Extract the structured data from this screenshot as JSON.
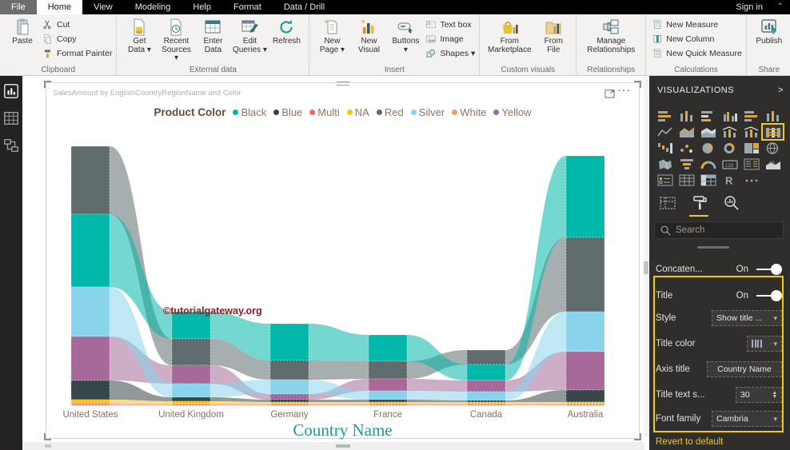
{
  "window": {
    "sign_in": "Sign in"
  },
  "tabs": [
    "File",
    "Home",
    "View",
    "Modeling",
    "Help",
    "Format",
    "Data / Drill"
  ],
  "active_tab": "Home",
  "ribbon": {
    "groups": [
      {
        "name": "Clipboard",
        "big": [
          {
            "id": "paste",
            "icon": "paste",
            "lines": [
              "Paste"
            ]
          }
        ],
        "small": [
          {
            "id": "cut",
            "icon": "cut",
            "label": "Cut"
          },
          {
            "id": "copy",
            "icon": "copy",
            "label": "Copy"
          },
          {
            "id": "format-painter",
            "icon": "painter",
            "label": "Format Painter"
          }
        ]
      },
      {
        "name": "External data",
        "big": [
          {
            "id": "get-data",
            "icon": "getdata",
            "lines": [
              "Get",
              "Data ▾"
            ]
          },
          {
            "id": "recent-sources",
            "icon": "recent",
            "lines": [
              "Recent",
              "Sources ▾"
            ]
          },
          {
            "id": "enter-data",
            "icon": "enterdata",
            "lines": [
              "Enter",
              "Data"
            ]
          },
          {
            "id": "edit-queries",
            "icon": "editq",
            "lines": [
              "Edit",
              "Queries ▾"
            ]
          },
          {
            "id": "refresh",
            "icon": "refresh",
            "lines": [
              "Refresh"
            ]
          }
        ]
      },
      {
        "name": "Insert",
        "big": [
          {
            "id": "new-page",
            "icon": "newpage",
            "lines": [
              "New",
              "Page ▾"
            ]
          },
          {
            "id": "new-visual",
            "icon": "newvisual",
            "lines": [
              "New",
              "Visual"
            ]
          },
          {
            "id": "buttons",
            "icon": "buttons",
            "lines": [
              "Buttons",
              "▾"
            ]
          }
        ],
        "small": [
          {
            "id": "text-box",
            "icon": "textbox",
            "label": "Text box"
          },
          {
            "id": "image",
            "icon": "image",
            "label": "Image"
          },
          {
            "id": "shapes",
            "icon": "shapes",
            "label": "Shapes ▾"
          }
        ]
      },
      {
        "name": "Custom visuals",
        "big": [
          {
            "id": "from-marketplace",
            "icon": "market",
            "lines": [
              "From",
              "Marketplace"
            ],
            "w": 62
          },
          {
            "id": "from-file",
            "icon": "fromfile",
            "lines": [
              "From",
              "File"
            ]
          }
        ]
      },
      {
        "name": "Relationships",
        "big": [
          {
            "id": "manage-relationships",
            "icon": "manage",
            "lines": [
              "Manage",
              "Relationships"
            ],
            "w": 74
          }
        ]
      },
      {
        "name": "Calculations",
        "small": [
          {
            "id": "new-measure",
            "icon": "measure",
            "label": "New Measure"
          },
          {
            "id": "new-column",
            "icon": "newcol",
            "label": "New Column"
          },
          {
            "id": "new-quick-measure",
            "icon": "quickm",
            "label": "New Quick Measure"
          }
        ]
      },
      {
        "name": "Share",
        "big": [
          {
            "id": "publish",
            "icon": "publish",
            "lines": [
              "Publish"
            ]
          }
        ]
      }
    ]
  },
  "sidebar": {
    "items": [
      {
        "id": "report-view",
        "icon": "report",
        "active": true
      },
      {
        "id": "data-view",
        "icon": "dataview",
        "active": false
      },
      {
        "id": "model-view",
        "icon": "modelview",
        "active": false
      }
    ]
  },
  "visual": {
    "title": "SalesAmount by EnglishCountryRegionName and Color",
    "watermark": "©tutorialgateway.org",
    "x_axis_title": "Country Name",
    "legend_title": "Product Color"
  },
  "chart_data": {
    "type": "ribbon",
    "title": "SalesAmount by EnglishCountryRegionName and Color",
    "xlabel": "Country Name",
    "ylabel": "SalesAmount",
    "legend_position": "top-center",
    "grid": false,
    "categories": [
      "United States",
      "United Kingdom",
      "Germany",
      "France",
      "Canada",
      "Australia"
    ],
    "series": [
      {
        "name": "Black",
        "color": "#01B8AA",
        "values": [
          91,
          34,
          46,
          33,
          20,
          102
        ]
      },
      {
        "name": "Blue",
        "color": "#374649",
        "values": [
          24,
          5,
          3,
          3,
          2,
          15
        ]
      },
      {
        "name": "Multi",
        "color": "#FD625E",
        "values": [
          1,
          1,
          1,
          1,
          1,
          1
        ]
      },
      {
        "name": "NA",
        "color": "#F2C80F",
        "values": [
          4,
          3,
          2,
          2,
          2,
          2
        ]
      },
      {
        "name": "Red",
        "color": "#5F6B6D",
        "values": [
          85,
          33,
          24,
          22,
          18,
          93
        ]
      },
      {
        "name": "Silver",
        "color": "#8AD4EB",
        "values": [
          62,
          17,
          18,
          11,
          11,
          50
        ]
      },
      {
        "name": "White",
        "color": "#FE9666",
        "values": [
          2,
          1,
          1,
          1,
          1,
          1
        ]
      },
      {
        "name": "Yellow",
        "color": "#A66999",
        "values": [
          55,
          23,
          7,
          15,
          14,
          48
        ]
      }
    ],
    "note": "values are relative SalesAmount magnitudes estimated from pixel heights",
    "stack_order_top_to_bottom": {
      "United States": [
        "Red",
        "Black",
        "Silver",
        "Yellow",
        "Blue",
        "NA",
        "White",
        "Multi"
      ],
      "United Kingdom": [
        "Black",
        "Red",
        "Yellow",
        "Silver",
        "Blue",
        "NA",
        "White",
        "Multi"
      ],
      "Germany": [
        "Black",
        "Red",
        "Silver",
        "Yellow",
        "Blue",
        "NA",
        "White",
        "Multi"
      ],
      "France": [
        "Black",
        "Red",
        "Yellow",
        "Silver",
        "Blue",
        "NA",
        "White",
        "Multi"
      ],
      "Canada": [
        "Red",
        "Black",
        "Yellow",
        "Silver",
        "Blue",
        "NA",
        "White",
        "Multi"
      ],
      "Australia": [
        "Black",
        "Red",
        "Silver",
        "Yellow",
        "Blue",
        "NA",
        "White",
        "Multi"
      ]
    },
    "ribbon_z_order": [
      "Multi",
      "White",
      "NA",
      "Blue",
      "Yellow",
      "Silver",
      "Red",
      "Black"
    ]
  },
  "panel": {
    "title": "VISUALIZATIONS",
    "collapse_chevron": ">",
    "visual_types": [
      "stacked-bar",
      "stacked-column",
      "clustered-bar",
      "clustered-column",
      "100-stacked-bar",
      "100-stacked-column",
      "line",
      "area",
      "stacked-area",
      "line-clustered-column",
      "line-stacked-column",
      "ribbon-chart",
      "waterfall",
      "scatter",
      "pie",
      "donut",
      "treemap",
      "map",
      "filled-map",
      "funnel",
      "gauge",
      "card",
      "multi-row-card",
      "kpi",
      "slicer",
      "table",
      "matrix",
      "r-script",
      "more-options"
    ],
    "selected_visual": "ribbon-chart",
    "search_placeholder": "Search",
    "rows": [
      {
        "id": "concatenate",
        "label": "Concaten...",
        "type": "toggle",
        "value": "On"
      },
      {
        "id": "title",
        "label": "Title",
        "type": "toggle",
        "value": "On"
      },
      {
        "id": "style",
        "label": "Style",
        "type": "dropdown",
        "value": "Show title ..."
      },
      {
        "id": "title-color",
        "label": "Title color",
        "type": "colorpick",
        "value": ""
      },
      {
        "id": "axis-title",
        "label": "Axis title",
        "type": "input",
        "value": "Country Name"
      },
      {
        "id": "title-text-size",
        "label": "Title text s...",
        "type": "spinner",
        "value": "30"
      },
      {
        "id": "font-family",
        "label": "Font family",
        "type": "dropdown",
        "value": "Cambria"
      }
    ],
    "revert_label": "Revert to default"
  }
}
